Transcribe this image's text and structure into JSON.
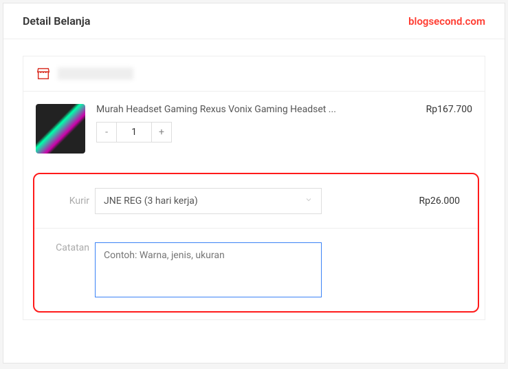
{
  "header": {
    "title": "Detail Belanja",
    "watermark": "blogsecond.com"
  },
  "product": {
    "title": "Murah Headset Gaming Rexus Vonix Gaming Headset ...",
    "price": "Rp167.700",
    "quantity": "1",
    "minus": "-",
    "plus": "+"
  },
  "courier": {
    "label": "Kurir",
    "selected": "JNE REG (3 hari kerja)",
    "price": "Rp26.000"
  },
  "note": {
    "label": "Catatan",
    "placeholder": "Contoh: Warna, jenis, ukuran"
  }
}
